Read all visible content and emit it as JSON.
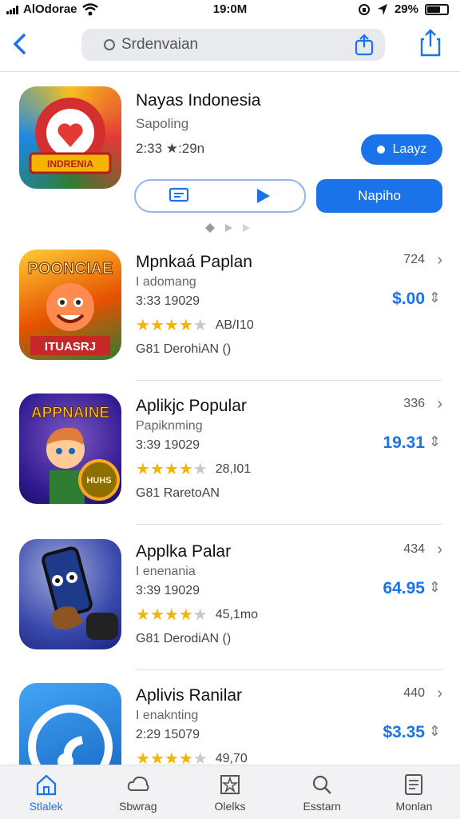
{
  "status_bar": {
    "carrier": "AlOdorae",
    "time": "19:0M",
    "battery_text": "29%"
  },
  "search": {
    "placeholder": "Srdenvaian"
  },
  "featured": {
    "title": "Nayas Indonesia",
    "subtitle": "Sapoling",
    "meta": "2:33 ★:29n",
    "pill_label": "Laayz",
    "primary_label": "Napiho",
    "icon_banner": "INDRENIA",
    "icon_colors": [
      "#f6c21b",
      "#e53935",
      "#2e7d32",
      "#1e88e5"
    ]
  },
  "apps": [
    {
      "title": "Mpnkaá Paplan",
      "subtitle": "I adomang",
      "meta": "3:33 19029",
      "rating": 4,
      "rating_count": "AB/I10",
      "footer": "G81 DerohiAN    ()",
      "number": "724",
      "price": "$.00",
      "icon_text": "POONCIAE",
      "icon_bottom": "ITUASRJ"
    },
    {
      "title": "Aplikjc Popular",
      "subtitle": "Papiknming",
      "meta": "3:39 19029",
      "rating": 4,
      "rating_count": "28,I01",
      "footer": "G81 RaretoAN",
      "number": "336",
      "price": "19.31",
      "icon_text": "APPNAINE",
      "icon_bottom": "HUHS"
    },
    {
      "title": "Applka Palar",
      "subtitle": "I enenania",
      "meta": "3:39 19029",
      "rating": 4,
      "rating_count": "45,1mo",
      "footer": "G81 DerodiAN    ()",
      "number": "434",
      "price": "64.95",
      "icon_text": "",
      "icon_bottom": ""
    },
    {
      "title": "Aplivis Ranilar",
      "subtitle": "I enaknting",
      "meta": "2:29 15079",
      "rating": 4,
      "rating_count": "49,70",
      "footer": "",
      "number": "440",
      "price": "$3.35",
      "icon_text": "",
      "icon_bottom": ""
    }
  ],
  "tabs": [
    {
      "label": "Stlalek",
      "icon": "house-icon",
      "active": true
    },
    {
      "label": "Sbwrag",
      "icon": "cloud-icon",
      "active": false
    },
    {
      "label": "Olelks",
      "icon": "star-map-icon",
      "active": false
    },
    {
      "label": "Esstarn",
      "icon": "search-icon",
      "active": false
    },
    {
      "label": "Monlan",
      "icon": "document-icon",
      "active": false
    }
  ],
  "colors": {
    "accent": "#1a73e8",
    "star": "#f5b400"
  }
}
